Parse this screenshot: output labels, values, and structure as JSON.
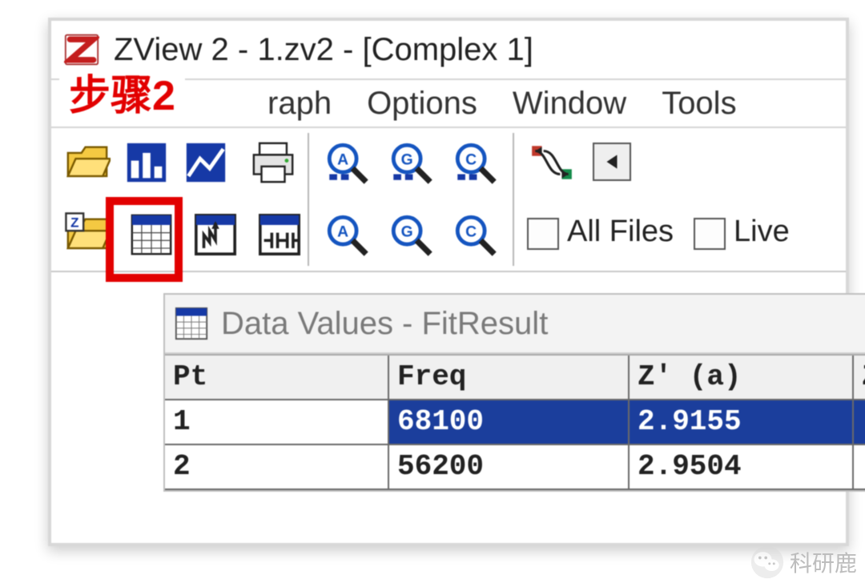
{
  "title": "ZView 2 - 1.zv2 - [Complex 1]",
  "step_label": "步骤2",
  "menu": {
    "graph": "raph",
    "options": "Options",
    "window": "Window",
    "tools": "Tools"
  },
  "toolbar": {
    "all_files_label": "All Files",
    "live_label": "Live"
  },
  "datawin": {
    "title": "Data Values - FitResult",
    "headers": [
      "Pt",
      "Freq",
      "Z' (a)",
      "Z"
    ],
    "rows": [
      {
        "pt": "1",
        "freq": "68100",
        "za": "2.9155",
        "selected": true
      },
      {
        "pt": "2",
        "freq": "56200",
        "za": "2.9504",
        "selected": false
      }
    ]
  },
  "watermark": "科研鹿"
}
